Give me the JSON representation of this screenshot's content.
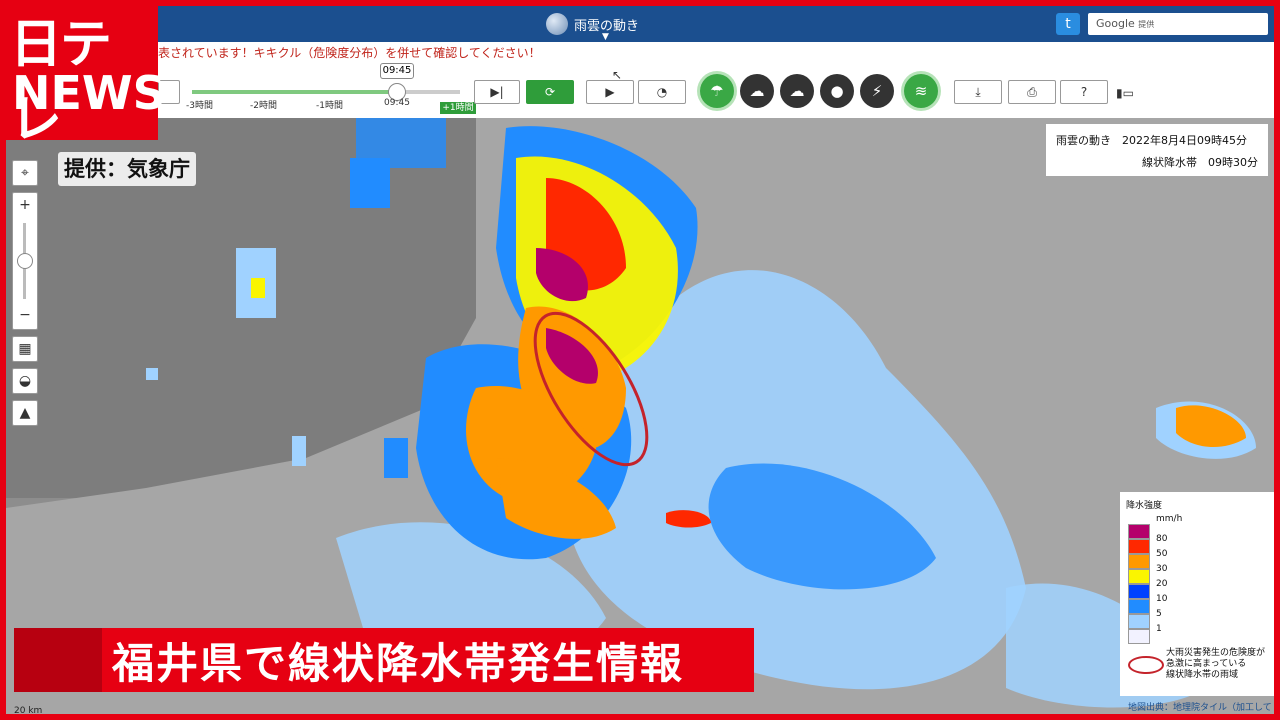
{
  "logo": {
    "line1": "日テレ",
    "line2": "NEWS"
  },
  "topbar": {
    "title": "雨雲の動き",
    "caret": "▼",
    "search_brand": "Google",
    "search_sub": "提供"
  },
  "warning_text": "表されています！キキクル（危険度分布）を併せて確認してください！",
  "slider": {
    "tooltip": "09:45",
    "ticks": [
      "-3時間",
      "-2時間",
      "-1時間",
      "09:45",
      "+1時間"
    ],
    "fill_fraction": 0.77
  },
  "credit": "提供：気象庁",
  "info": {
    "line1": "雨雲の動き　2022年8月4日09時45分",
    "line2": "線状降水帯　09時30分"
  },
  "legend": {
    "title": "降水強度",
    "unit": "mm/h",
    "levels": [
      {
        "label": "80",
        "color": "#b4006b"
      },
      {
        "label": "50",
        "color": "#ff2800"
      },
      {
        "label": "30",
        "color": "#ff9900"
      },
      {
        "label": "20",
        "color": "#faf500"
      },
      {
        "label": "10",
        "color": "#0041ff"
      },
      {
        "label": "5",
        "color": "#218cff"
      },
      {
        "label": "1",
        "color": "#a0d2ff"
      },
      {
        "label": "",
        "color": "#f2f2ff"
      }
    ],
    "note_line1": "大雨災害発生の危険度が",
    "note_line2": "急激に高まっている",
    "note_line3": "線状降水帯の雨域"
  },
  "attribution": "地図出典：地理院タイル（加工して利用）",
  "scale": "20 km",
  "caption": "福井県で線状降水帯発生情報"
}
